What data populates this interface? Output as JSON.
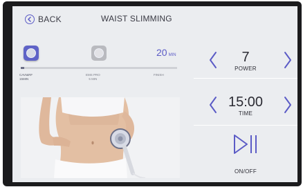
{
  "header": {
    "back_label": "BACK",
    "title": "WAIST SLIMMING"
  },
  "program": {
    "active_mode_icon": "massage-head-icon",
    "inactive_mode_icon": "rf-head-icon",
    "minutes_value": "20",
    "minutes_unit": "MIN",
    "progress_fraction": 0.02,
    "ticks": [
      {
        "line1": "CAVI&RF",
        "line2": "15MIN"
      },
      {
        "line1": "EMS PRO",
        "line2": "5 MIN"
      },
      {
        "line1": "FINISH",
        "line2": ""
      }
    ]
  },
  "power": {
    "value": "7",
    "label": "POWER"
  },
  "time": {
    "value": "15:00",
    "label": "TIME"
  },
  "onoff": {
    "icon": "play-pause-icon",
    "label": "ON/OFF"
  },
  "colors": {
    "accent": "#5b5bc6",
    "bezel": "#1b1b1d",
    "screen": "#ebedf0"
  }
}
